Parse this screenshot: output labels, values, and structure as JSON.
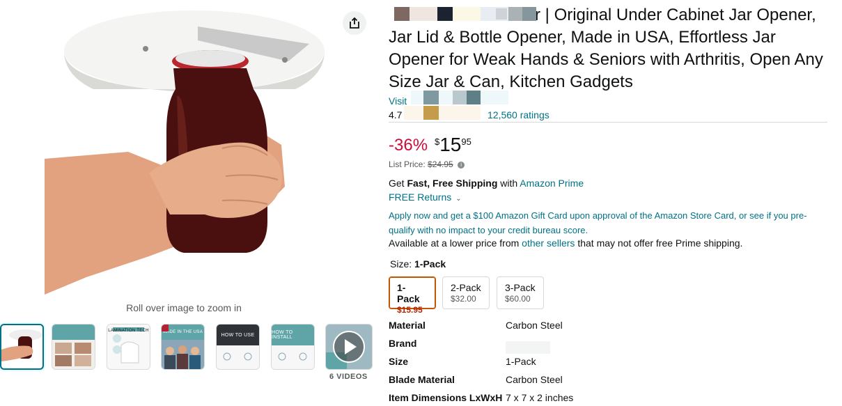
{
  "gallery": {
    "share_icon": "share-icon",
    "zoom_hint": "Roll over image to zoom in",
    "thumbnails": [
      {
        "label": ""
      },
      {
        "label": ""
      },
      {
        "label": "LAMINATION TECH"
      },
      {
        "label": "MADE IN THE USA"
      },
      {
        "label": "HOW TO USE"
      },
      {
        "label": "HOW TO INSTALL"
      },
      {
        "label": ""
      }
    ],
    "videos_label": "6 VIDEOS"
  },
  "product": {
    "title_visible": "r | Original Under Cabinet Jar Opener, Jar Lid & Bottle Opener, Made in USA, Effortless Jar Opener for Weak Hands & Seniors with Arthritis, Open Any Size Jar & Can, Kitchen Gadgets",
    "visit_link": "Visit",
    "rating": "4.7",
    "rating_count": "12,560 ratings"
  },
  "pricing": {
    "discount": "-36%",
    "currency": "$",
    "price_whole": "15",
    "price_fraction": "95",
    "list_price_label": "List Price:",
    "list_price": "$24.95"
  },
  "delivery": {
    "get": "Get",
    "fast_free": "Fast, Free Shipping",
    "with": "with",
    "prime_link": "Amazon Prime",
    "returns": "FREE Returns",
    "card_offer": "Apply now and get a $100 Amazon Gift Card upon approval of the Amazon Store Card, or see if you pre-qualify with no impact to your credit bureau score.",
    "lower_price_pre": "Available at a lower price from",
    "lower_price_link": "other sellers",
    "lower_price_post": "that may not offer free Prime shipping."
  },
  "size": {
    "label": "Size:",
    "selected": "1-Pack",
    "options": [
      {
        "name": "1-Pack",
        "price": "$15.95"
      },
      {
        "name": "2-Pack",
        "price": "$32.00"
      },
      {
        "name": "3-Pack",
        "price": "$60.00"
      }
    ]
  },
  "specs": [
    {
      "key": "Material",
      "value": "Carbon Steel"
    },
    {
      "key": "Brand",
      "value": ""
    },
    {
      "key": "Size",
      "value": "1-Pack"
    },
    {
      "key": "Blade Material",
      "value": "Carbon Steel"
    },
    {
      "key": "Item Dimensions LxWxH",
      "value": "7 x 7 x 2 inches"
    }
  ],
  "colors": {
    "link": "#007185",
    "discount": "#cc0c39",
    "selected_border": "#c45500"
  }
}
